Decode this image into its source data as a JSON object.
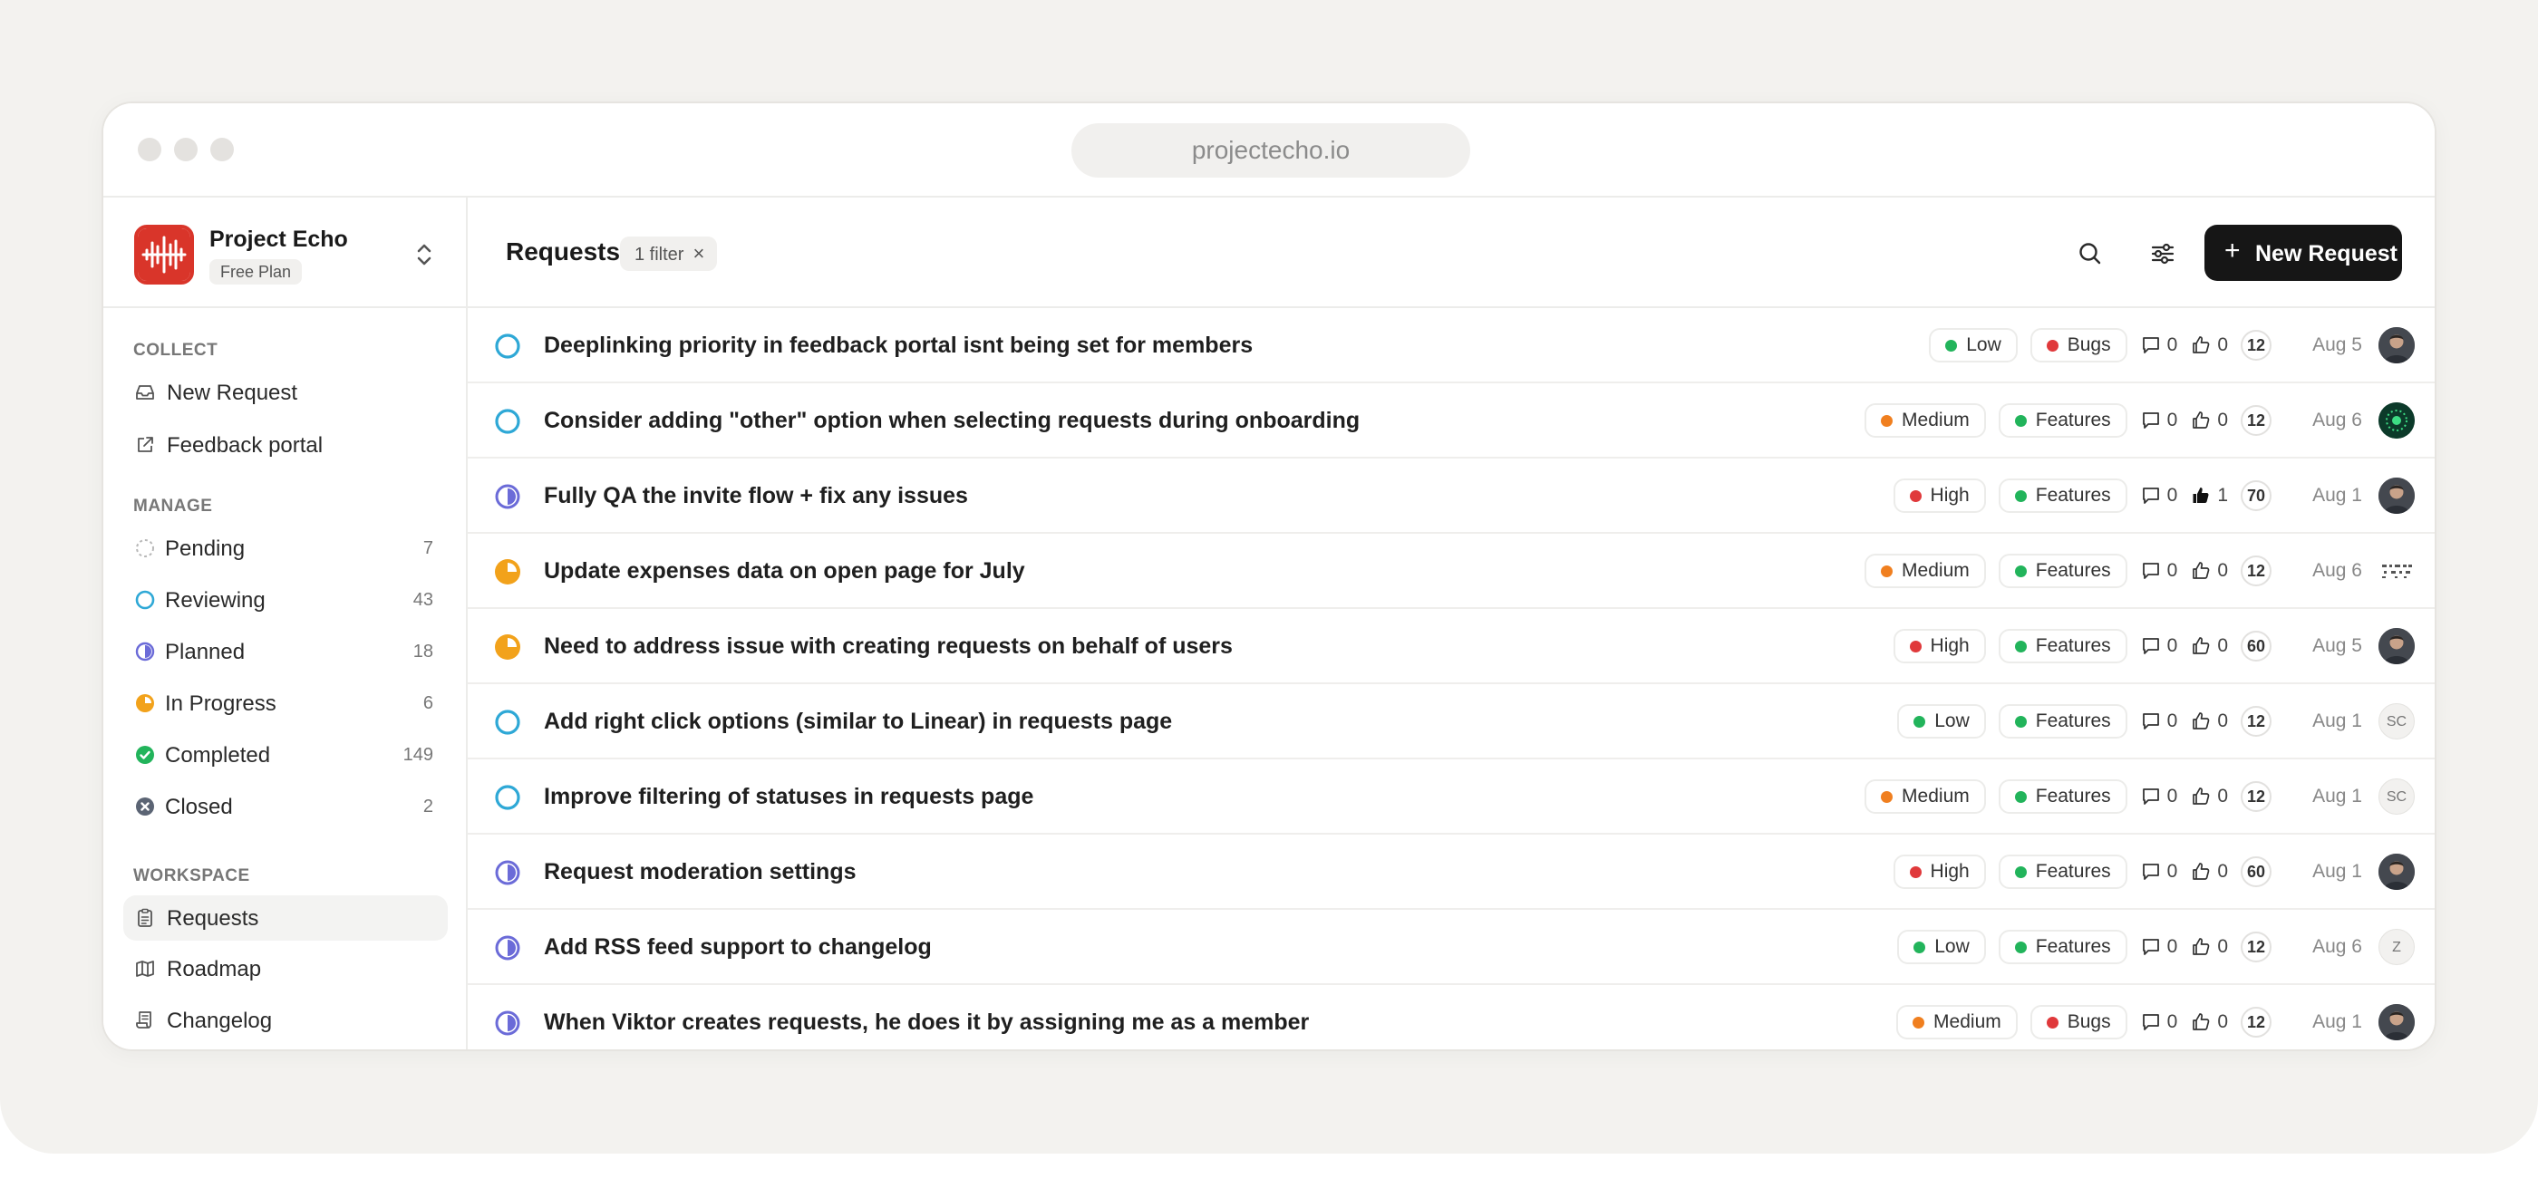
{
  "window": {
    "url": "projectecho.io"
  },
  "brand": {
    "name": "Project Echo",
    "plan": "Free Plan"
  },
  "sidebar": {
    "sections": {
      "collect": "COLLECT",
      "manage": "MANAGE",
      "workspace": "WORKSPACE"
    },
    "collect": [
      {
        "label": "New Request",
        "icon": "inbox-icon"
      },
      {
        "label": "Feedback portal",
        "icon": "external-link-icon"
      }
    ],
    "manage": [
      {
        "label": "Pending",
        "count": "7",
        "icon": "status-pending-icon",
        "color": "#b8b8b8"
      },
      {
        "label": "Reviewing",
        "count": "43",
        "icon": "status-reviewing-icon",
        "color": "#2ea8d6"
      },
      {
        "label": "Planned",
        "count": "18",
        "icon": "status-planned-icon",
        "color": "#6b6bd8"
      },
      {
        "label": "In Progress",
        "count": "6",
        "icon": "status-in-progress-icon",
        "color": "#f2a21b"
      },
      {
        "label": "Completed",
        "count": "149",
        "icon": "status-completed-icon",
        "color": "#22b45b"
      },
      {
        "label": "Closed",
        "count": "2",
        "icon": "status-closed-icon",
        "color": "#5b6474"
      }
    ],
    "workspace": [
      {
        "label": "Requests",
        "icon": "clipboard-icon",
        "active": true
      },
      {
        "label": "Roadmap",
        "icon": "map-icon"
      },
      {
        "label": "Changelog",
        "icon": "scroll-icon"
      }
    ]
  },
  "header": {
    "title": "Requests",
    "filter_chip": "1 filter",
    "filter_remove": "×",
    "new_button": "New Request",
    "new_button_plus": "+"
  },
  "colors": {
    "low": "#22b45b",
    "medium": "#f07f1f",
    "high": "#e0393b",
    "features": "#22b45b",
    "bugs": "#e0393b"
  },
  "requests": [
    {
      "status": "reviewing",
      "title": "Deeplinking priority in feedback portal isnt being set for members",
      "priority": "Low",
      "priority_color": "#22b45b",
      "tag": "Bugs",
      "tag_color": "#e0393b",
      "comments": "0",
      "votes": "0",
      "voted": false,
      "badge": "12",
      "date": "Aug 5",
      "avatar": "photo"
    },
    {
      "status": "reviewing",
      "title": "Consider adding \"other\" option when selecting requests during onboarding",
      "priority": "Medium",
      "priority_color": "#f07f1f",
      "tag": "Features",
      "tag_color": "#22b45b",
      "comments": "0",
      "votes": "0",
      "voted": false,
      "badge": "12",
      "date": "Aug 6",
      "avatar": "green"
    },
    {
      "status": "planned",
      "title": "Fully QA the invite flow + fix any issues",
      "priority": "High",
      "priority_color": "#e0393b",
      "tag": "Features",
      "tag_color": "#22b45b",
      "comments": "0",
      "votes": "1",
      "voted": true,
      "badge": "70",
      "date": "Aug 1",
      "avatar": "photo"
    },
    {
      "status": "in-progress",
      "title": "Update expenses data on open page for July",
      "priority": "Medium",
      "priority_color": "#f07f1f",
      "tag": "Features",
      "tag_color": "#22b45b",
      "comments": "0",
      "votes": "0",
      "voted": false,
      "badge": "12",
      "date": "Aug 6",
      "avatar": "pattern"
    },
    {
      "status": "in-progress",
      "title": "Need to address issue with creating requests on behalf of users",
      "priority": "High",
      "priority_color": "#e0393b",
      "tag": "Features",
      "tag_color": "#22b45b",
      "comments": "0",
      "votes": "0",
      "voted": false,
      "badge": "60",
      "date": "Aug 5",
      "avatar": "photo"
    },
    {
      "status": "reviewing",
      "title": "Add right click options (similar to Linear) in requests page",
      "priority": "Low",
      "priority_color": "#22b45b",
      "tag": "Features",
      "tag_color": "#22b45b",
      "comments": "0",
      "votes": "0",
      "voted": false,
      "badge": "12",
      "date": "Aug 1",
      "avatar": "initials",
      "initials": "SC"
    },
    {
      "status": "reviewing",
      "title": "Improve filtering of statuses in requests page",
      "priority": "Medium",
      "priority_color": "#f07f1f",
      "tag": "Features",
      "tag_color": "#22b45b",
      "comments": "0",
      "votes": "0",
      "voted": false,
      "badge": "12",
      "date": "Aug 1",
      "avatar": "initials",
      "initials": "SC"
    },
    {
      "status": "planned",
      "title": "Request moderation settings",
      "priority": "High",
      "priority_color": "#e0393b",
      "tag": "Features",
      "tag_color": "#22b45b",
      "comments": "0",
      "votes": "0",
      "voted": false,
      "badge": "60",
      "date": "Aug 1",
      "avatar": "photo"
    },
    {
      "status": "planned",
      "title": "Add RSS feed support to changelog",
      "priority": "Low",
      "priority_color": "#22b45b",
      "tag": "Features",
      "tag_color": "#22b45b",
      "comments": "0",
      "votes": "0",
      "voted": false,
      "badge": "12",
      "date": "Aug 6",
      "avatar": "initials",
      "initials": "Z"
    },
    {
      "status": "planned",
      "title": "When Viktor creates requests, he does it by assigning me as a member",
      "priority": "Medium",
      "priority_color": "#f07f1f",
      "tag": "Bugs",
      "tag_color": "#e0393b",
      "comments": "0",
      "votes": "0",
      "voted": false,
      "badge": "12",
      "date": "Aug 1",
      "avatar": "photo"
    }
  ]
}
